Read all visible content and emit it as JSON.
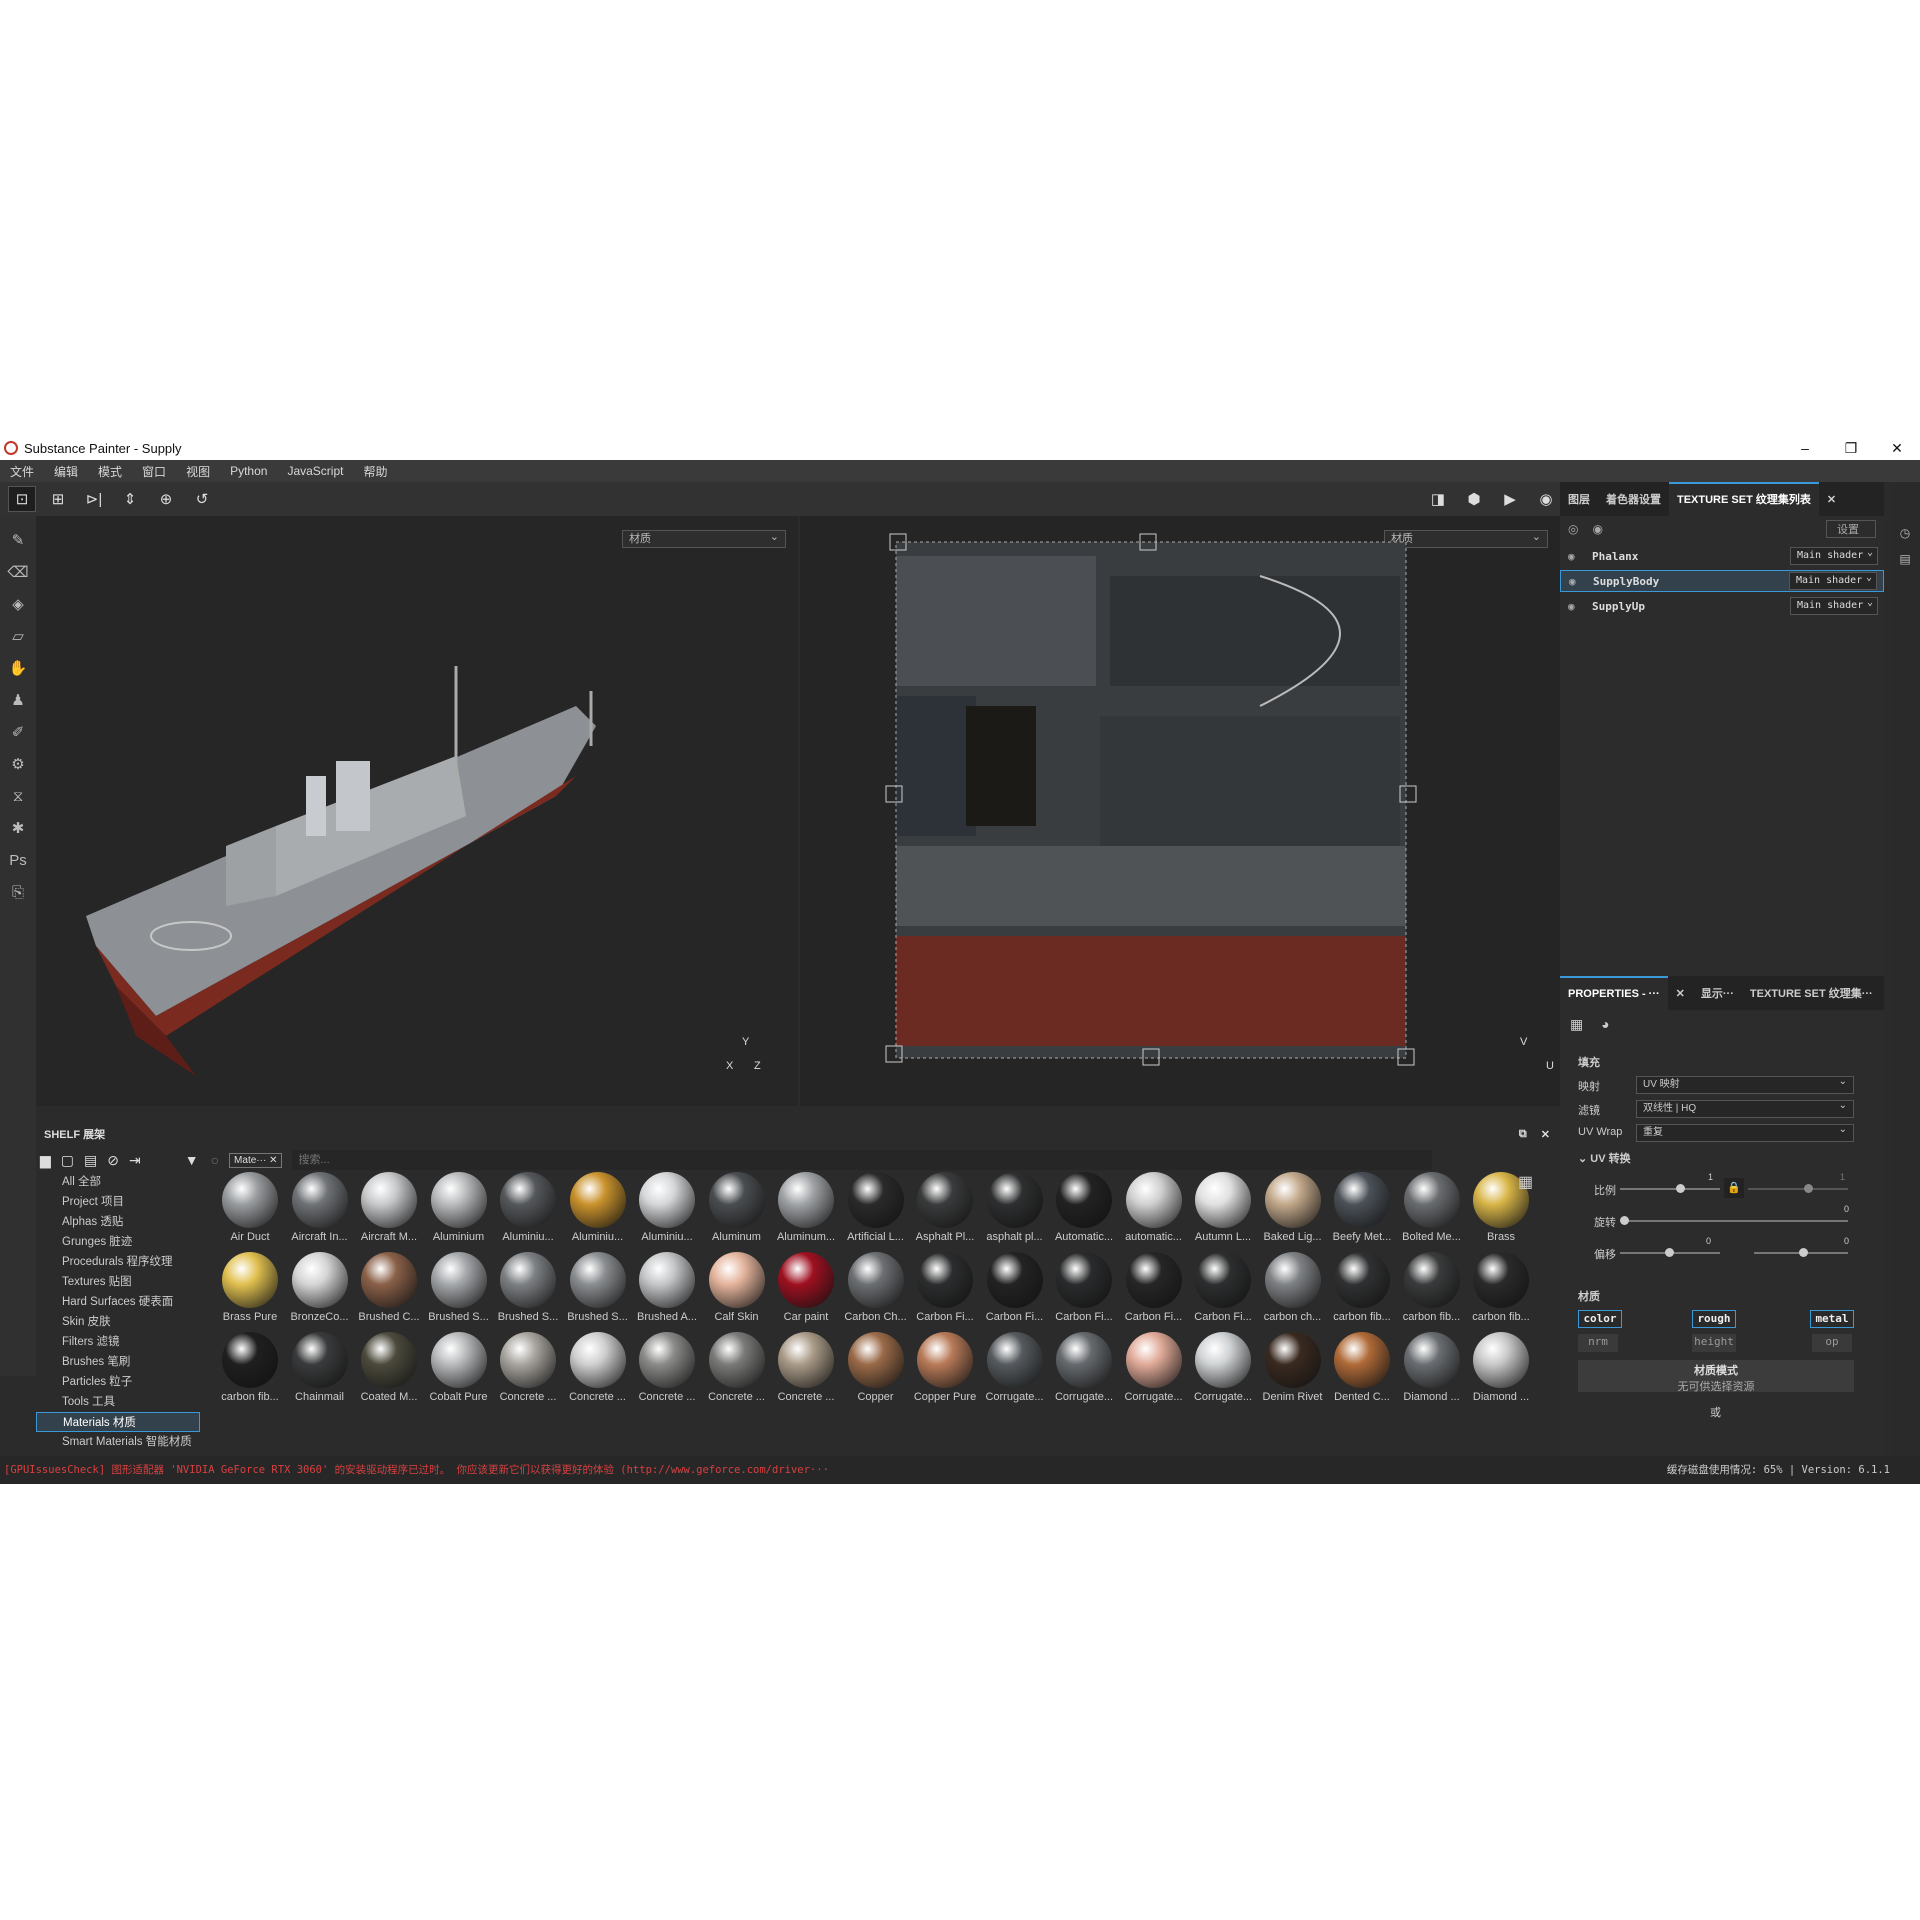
{
  "app": {
    "title": "Substance Painter - Supply"
  },
  "menu": [
    "文件",
    "编辑",
    "模式",
    "窗口",
    "视图",
    "Python",
    "JavaScript",
    "帮助"
  ],
  "viewport": {
    "left_select": "材质",
    "right_select": "材质",
    "axis3d": {
      "y": "Y",
      "x": "X",
      "z": "Z"
    },
    "axis2d": {
      "v": "V",
      "u": "U"
    }
  },
  "right_tabs": [
    "图层",
    "着色器设置",
    "TEXTURE SET 纹理集列表"
  ],
  "texture_set_list": {
    "settings_label": "设置",
    "items": [
      {
        "name": "Phalanx",
        "shader": "Main shader"
      },
      {
        "name": "SupplyBody",
        "shader": "Main shader"
      },
      {
        "name": "SupplyUp",
        "shader": "Main shader"
      }
    ]
  },
  "properties": {
    "tabs": [
      "PROPERTIES - ···",
      "显示···",
      "TEXTURE SET 纹理集···"
    ],
    "fill_title": "填充",
    "mapping_label": "映射",
    "mapping_value": "UV 映射",
    "filter_label": "滤镜",
    "filter_value": "双线性 | HQ",
    "uvwrap_label": "UV Wrap",
    "uvwrap_value": "重复",
    "uv_transform_title": "UV 转换",
    "scale_label": "比例",
    "scale_value": "1",
    "scale_value2": "1",
    "rotate_label": "旋转",
    "rotate_value": "0",
    "offset_label": "偏移",
    "offset_value_u": "0",
    "offset_value_v": "0",
    "material_title": "材质",
    "channels_on": [
      "color",
      "rough",
      "metal"
    ],
    "channels_off": [
      "nrm",
      "height",
      "op"
    ],
    "material_mode_label": "材质模式",
    "material_mode_sub": "无可供选择资源",
    "or_label": "或"
  },
  "shelf": {
    "title": "SHELF 展架",
    "filter_tag": "Mate···",
    "search_placeholder": "搜索...",
    "categories": [
      "All 全部",
      "Project 项目",
      "Alphas 透贴",
      "Grunges 脏迹",
      "Procedurals 程序纹理",
      "Textures 贴图",
      "Hard Surfaces 硬表面",
      "Skin 皮肤",
      "Filters 滤镜",
      "Brushes 笔刷",
      "Particles 粒子",
      "Tools 工具",
      "Materials 材质",
      "Smart Materials 智能材质"
    ],
    "selected_category": "Materials 材质",
    "materials": [
      "Air Duct",
      "Aircraft In...",
      "Aircraft M...",
      "Aluminium",
      "Aluminiu...",
      "Aluminiu...",
      "Aluminiu...",
      "Aluminum",
      "Aluminum...",
      "Artificial L...",
      "Asphalt Pl...",
      "asphalt pl...",
      "Automatic...",
      "automatic...",
      "Autumn L...",
      "Baked Lig...",
      "Beefy Met...",
      "Bolted Me...",
      "Brass",
      "Brass Pure",
      "BronzeCo...",
      "Brushed C...",
      "Brushed S...",
      "Brushed S...",
      "Brushed S...",
      "Brushed A...",
      "Calf Skin",
      "Car paint",
      "Carbon Ch...",
      "Carbon Fi...",
      "Carbon Fi...",
      "Carbon Fi...",
      "Carbon Fi...",
      "Carbon Fi...",
      "carbon ch...",
      "carbon fib...",
      "carbon fib...",
      "carbon fib...",
      "carbon fib...",
      "Chainmail",
      "Coated M...",
      "Cobalt Pure",
      "Concrete ...",
      "Concrete ...",
      "Concrete ...",
      "Concrete ...",
      "Concrete ...",
      "Copper",
      "Copper Pure",
      "Corrugate...",
      "Corrugate...",
      "Corrugate...",
      "Corrugate...",
      "Denim Rivet",
      "Dented C...",
      "Diamond ...",
      "Diamond ..."
    ]
  },
  "status": {
    "error": "[GPUIssuesCheck] 图形适配器 'NVIDIA GeForce RTX 3060' 的安装驱动程序已过时。 你应该更新它们以获得更好的体验 (http://www.geforce.com/driver···",
    "cache": "缓存磁盘使用情况: 65% | Version: 6.1.1"
  }
}
